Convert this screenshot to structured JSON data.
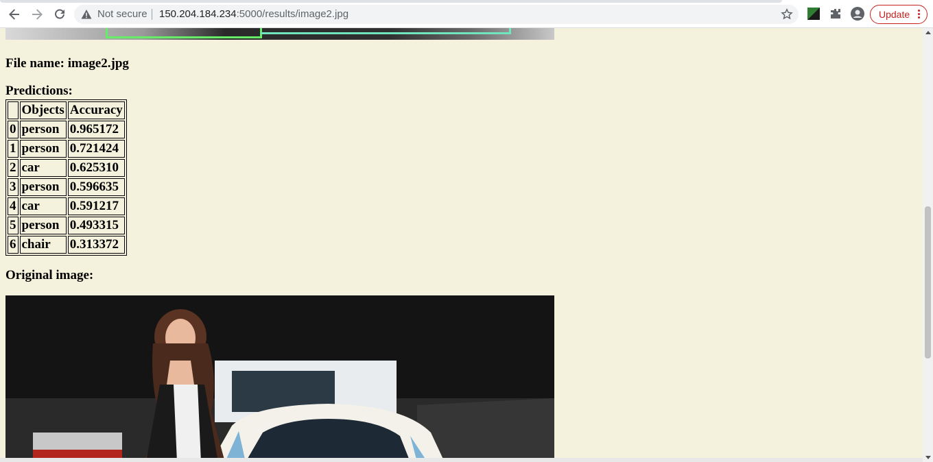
{
  "browser": {
    "security_label": "Not secure",
    "url_host": "150.204.184.234",
    "url_path": ":5000/results/image2.jpg",
    "update_label": "Update"
  },
  "page": {
    "file_name_heading": "File name: image2.jpg",
    "predictions_heading": "Predictions:",
    "original_heading": "Original image:",
    "table": {
      "headers": [
        "",
        "Objects",
        "Accuracy"
      ],
      "rows": [
        {
          "idx": "0",
          "object": "person",
          "accuracy": "0.965172"
        },
        {
          "idx": "1",
          "object": "person",
          "accuracy": "0.721424"
        },
        {
          "idx": "2",
          "object": "car",
          "accuracy": "0.625310"
        },
        {
          "idx": "3",
          "object": "person",
          "accuracy": "0.596635"
        },
        {
          "idx": "4",
          "object": "car",
          "accuracy": "0.591217"
        },
        {
          "idx": "5",
          "object": "person",
          "accuracy": "0.493315"
        },
        {
          "idx": "6",
          "object": "chair",
          "accuracy": "0.313372"
        }
      ]
    }
  },
  "colors": {
    "page_background": "#f4f2dc",
    "update_red": "#c5221f"
  }
}
